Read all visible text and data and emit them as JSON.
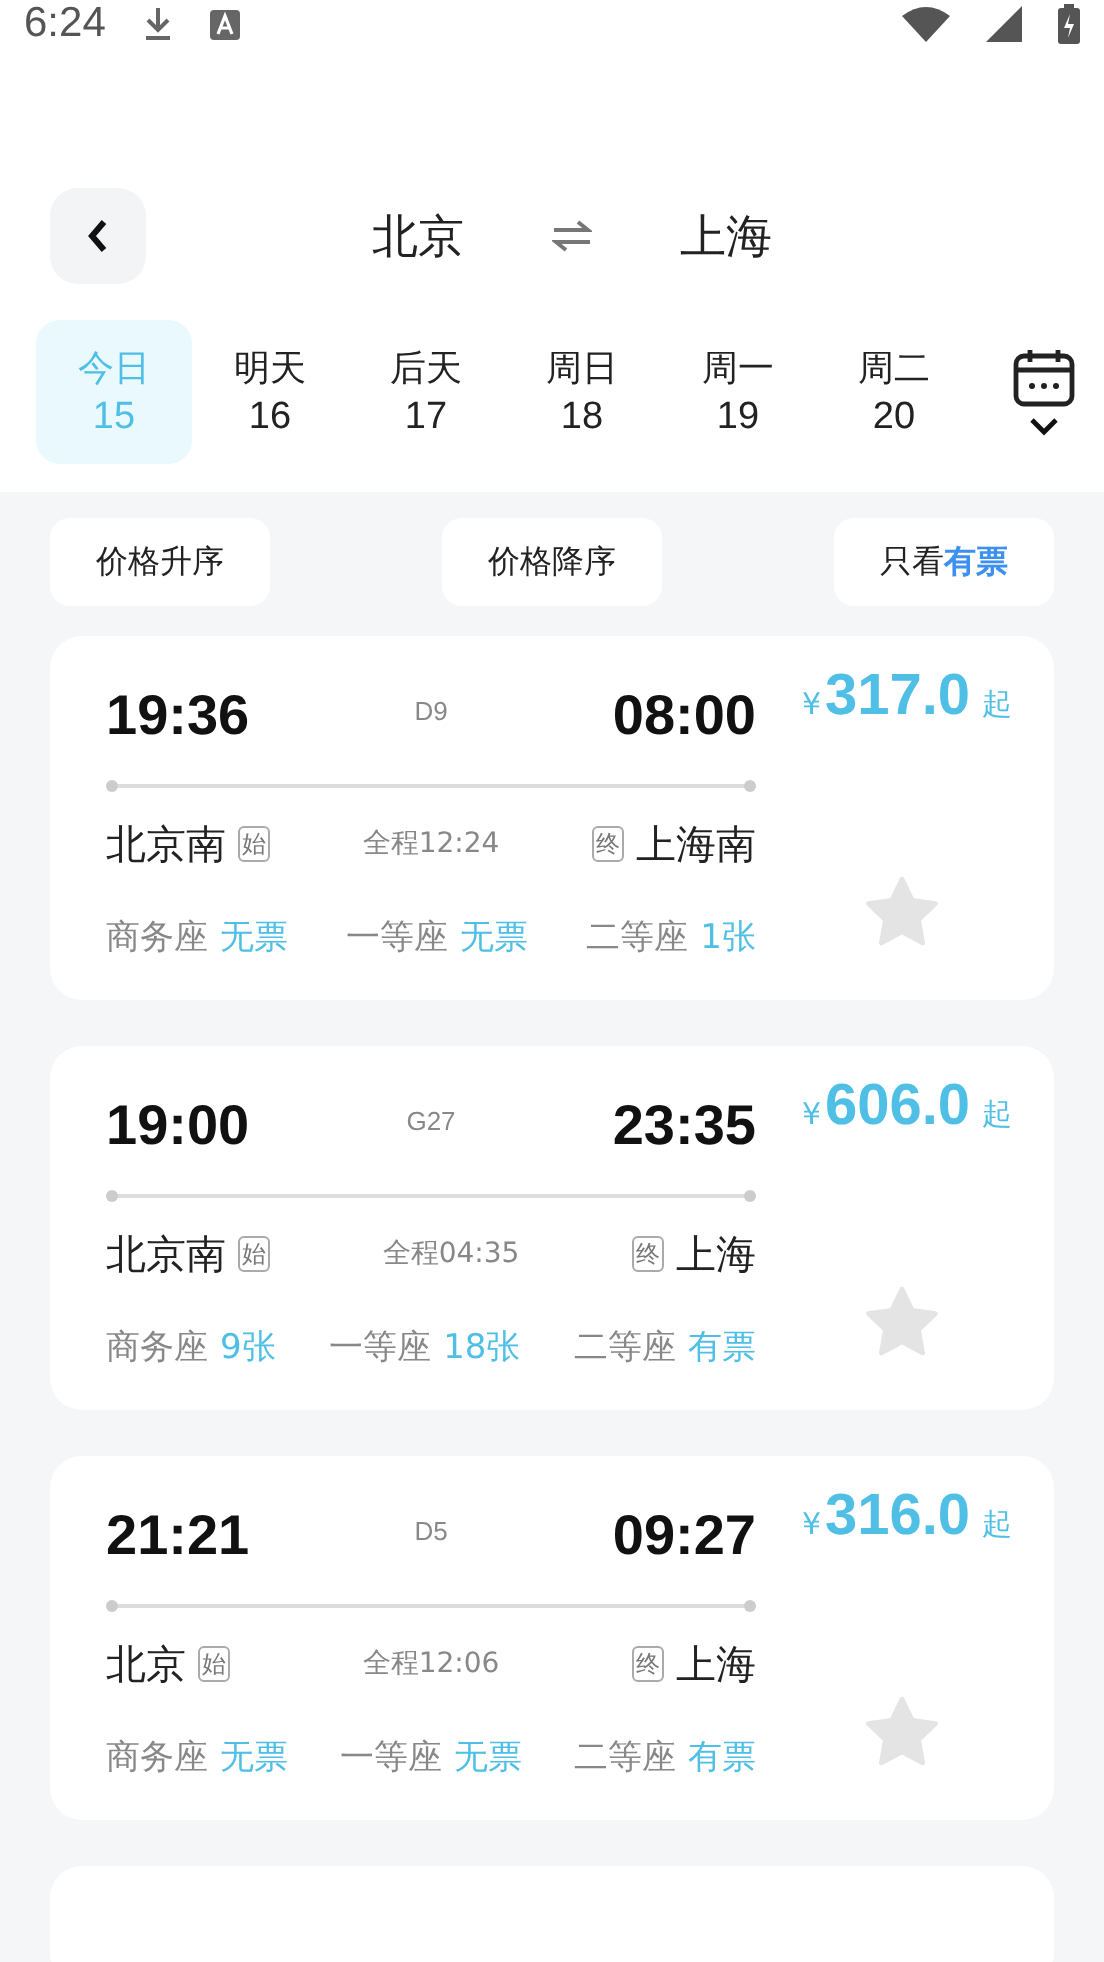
{
  "status_bar": {
    "time": "6:24"
  },
  "header": {
    "from": "北京",
    "to": "上海"
  },
  "dates": [
    {
      "day": "今日",
      "date": "15",
      "selected": true
    },
    {
      "day": "明天",
      "date": "16",
      "selected": false
    },
    {
      "day": "后天",
      "date": "17",
      "selected": false
    },
    {
      "day": "周日",
      "date": "18",
      "selected": false
    },
    {
      "day": "周一",
      "date": "19",
      "selected": false
    },
    {
      "day": "周二",
      "date": "20",
      "selected": false
    }
  ],
  "sort_buttons": [
    {
      "label": "价格升序"
    },
    {
      "label": "价格降序"
    },
    {
      "label": "只看",
      "highlight": "有票"
    }
  ],
  "trains": [
    {
      "depart": "19:36",
      "train_no": "D9",
      "arrive": "08:00",
      "currency": "¥",
      "price": "317.0",
      "price_suffix": "起",
      "from_station": "北京南",
      "from_tag": "始",
      "duration": "全程12:24",
      "to_tag": "终",
      "to_station": "上海南",
      "seats": [
        {
          "class": "商务座",
          "availability": "无票"
        },
        {
          "class": "一等座",
          "availability": "无票"
        },
        {
          "class": "二等座",
          "availability": "1张"
        }
      ],
      "favorite": false
    },
    {
      "depart": "19:00",
      "train_no": "G27",
      "arrive": "23:35",
      "currency": "¥",
      "price": "606.0",
      "price_suffix": "起",
      "from_station": "北京南",
      "from_tag": "始",
      "duration": "全程04:35",
      "to_tag": "终",
      "to_station": "上海",
      "seats": [
        {
          "class": "商务座",
          "availability": "9张"
        },
        {
          "class": "一等座",
          "availability": "18张"
        },
        {
          "class": "二等座",
          "availability": "有票"
        }
      ],
      "favorite": false
    },
    {
      "depart": "21:21",
      "train_no": "D5",
      "arrive": "09:27",
      "currency": "¥",
      "price": "316.0",
      "price_suffix": "起",
      "from_station": "北京",
      "from_tag": "始",
      "duration": "全程12:06",
      "to_tag": "终",
      "to_station": "上海",
      "seats": [
        {
          "class": "商务座",
          "availability": "无票"
        },
        {
          "class": "一等座",
          "availability": "无票"
        },
        {
          "class": "二等座",
          "availability": "有票"
        }
      ],
      "favorite": false
    }
  ]
}
